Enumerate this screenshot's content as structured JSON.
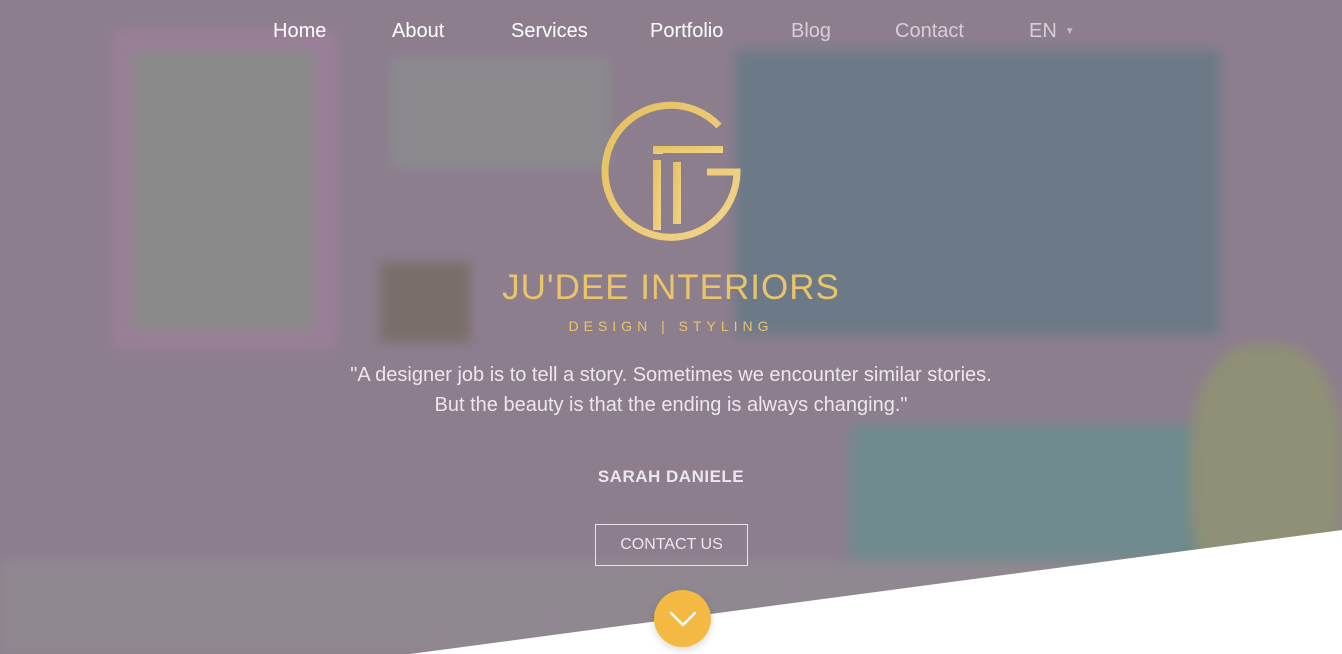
{
  "nav": {
    "items": [
      {
        "label": "Home"
      },
      {
        "label": "About"
      },
      {
        "label": "Services"
      },
      {
        "label": "Portfolio"
      },
      {
        "label": "Blog"
      },
      {
        "label": "Contact"
      }
    ],
    "language": "EN"
  },
  "brand": {
    "name": "JU'DEE INTERIORS",
    "tagline": "DESIGN | STYLING"
  },
  "quote": {
    "line1": "\"A designer job is to tell a story. Sometimes we encounter similar stories.",
    "line2": "But the beauty is that the ending is always changing.\"",
    "author": "SARAH DANIELE"
  },
  "cta": {
    "label": "CONTACT US"
  },
  "icons": {
    "logo": "jd-monogram-logo",
    "scroll": "chevron-down-icon",
    "language_caret": "caret-down-icon"
  },
  "colors": {
    "accent_gold": "#e9c46a",
    "scroll_button": "#f4b942",
    "overlay": "#8d7e8e"
  }
}
